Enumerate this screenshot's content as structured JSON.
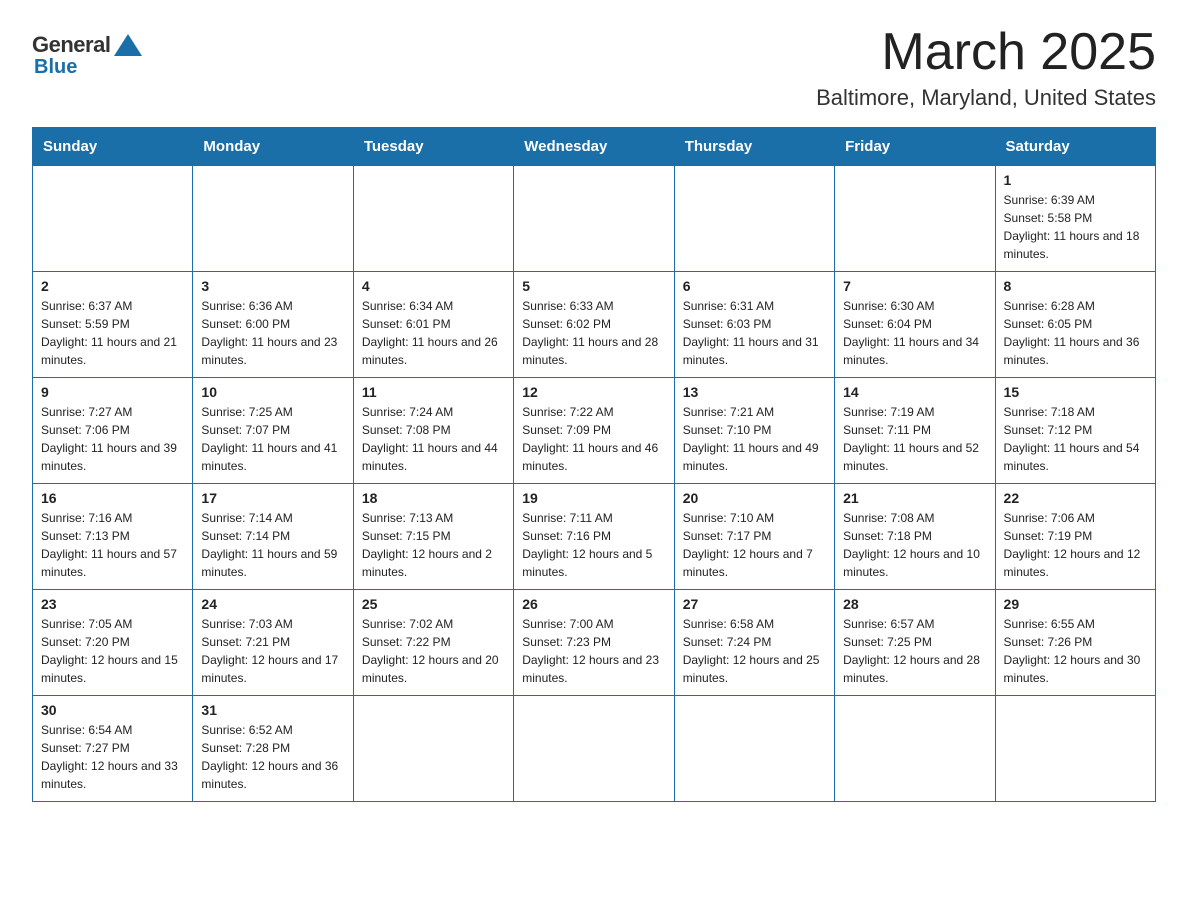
{
  "logo": {
    "general": "General",
    "blue": "Blue"
  },
  "title": "March 2025",
  "subtitle": "Baltimore, Maryland, United States",
  "days_of_week": [
    "Sunday",
    "Monday",
    "Tuesday",
    "Wednesday",
    "Thursday",
    "Friday",
    "Saturday"
  ],
  "weeks": [
    [
      {
        "day": "",
        "info": ""
      },
      {
        "day": "",
        "info": ""
      },
      {
        "day": "",
        "info": ""
      },
      {
        "day": "",
        "info": ""
      },
      {
        "day": "",
        "info": ""
      },
      {
        "day": "",
        "info": ""
      },
      {
        "day": "1",
        "info": "Sunrise: 6:39 AM\nSunset: 5:58 PM\nDaylight: 11 hours and 18 minutes."
      }
    ],
    [
      {
        "day": "2",
        "info": "Sunrise: 6:37 AM\nSunset: 5:59 PM\nDaylight: 11 hours and 21 minutes."
      },
      {
        "day": "3",
        "info": "Sunrise: 6:36 AM\nSunset: 6:00 PM\nDaylight: 11 hours and 23 minutes."
      },
      {
        "day": "4",
        "info": "Sunrise: 6:34 AM\nSunset: 6:01 PM\nDaylight: 11 hours and 26 minutes."
      },
      {
        "day": "5",
        "info": "Sunrise: 6:33 AM\nSunset: 6:02 PM\nDaylight: 11 hours and 28 minutes."
      },
      {
        "day": "6",
        "info": "Sunrise: 6:31 AM\nSunset: 6:03 PM\nDaylight: 11 hours and 31 minutes."
      },
      {
        "day": "7",
        "info": "Sunrise: 6:30 AM\nSunset: 6:04 PM\nDaylight: 11 hours and 34 minutes."
      },
      {
        "day": "8",
        "info": "Sunrise: 6:28 AM\nSunset: 6:05 PM\nDaylight: 11 hours and 36 minutes."
      }
    ],
    [
      {
        "day": "9",
        "info": "Sunrise: 7:27 AM\nSunset: 7:06 PM\nDaylight: 11 hours and 39 minutes."
      },
      {
        "day": "10",
        "info": "Sunrise: 7:25 AM\nSunset: 7:07 PM\nDaylight: 11 hours and 41 minutes."
      },
      {
        "day": "11",
        "info": "Sunrise: 7:24 AM\nSunset: 7:08 PM\nDaylight: 11 hours and 44 minutes."
      },
      {
        "day": "12",
        "info": "Sunrise: 7:22 AM\nSunset: 7:09 PM\nDaylight: 11 hours and 46 minutes."
      },
      {
        "day": "13",
        "info": "Sunrise: 7:21 AM\nSunset: 7:10 PM\nDaylight: 11 hours and 49 minutes."
      },
      {
        "day": "14",
        "info": "Sunrise: 7:19 AM\nSunset: 7:11 PM\nDaylight: 11 hours and 52 minutes."
      },
      {
        "day": "15",
        "info": "Sunrise: 7:18 AM\nSunset: 7:12 PM\nDaylight: 11 hours and 54 minutes."
      }
    ],
    [
      {
        "day": "16",
        "info": "Sunrise: 7:16 AM\nSunset: 7:13 PM\nDaylight: 11 hours and 57 minutes."
      },
      {
        "day": "17",
        "info": "Sunrise: 7:14 AM\nSunset: 7:14 PM\nDaylight: 11 hours and 59 minutes."
      },
      {
        "day": "18",
        "info": "Sunrise: 7:13 AM\nSunset: 7:15 PM\nDaylight: 12 hours and 2 minutes."
      },
      {
        "day": "19",
        "info": "Sunrise: 7:11 AM\nSunset: 7:16 PM\nDaylight: 12 hours and 5 minutes."
      },
      {
        "day": "20",
        "info": "Sunrise: 7:10 AM\nSunset: 7:17 PM\nDaylight: 12 hours and 7 minutes."
      },
      {
        "day": "21",
        "info": "Sunrise: 7:08 AM\nSunset: 7:18 PM\nDaylight: 12 hours and 10 minutes."
      },
      {
        "day": "22",
        "info": "Sunrise: 7:06 AM\nSunset: 7:19 PM\nDaylight: 12 hours and 12 minutes."
      }
    ],
    [
      {
        "day": "23",
        "info": "Sunrise: 7:05 AM\nSunset: 7:20 PM\nDaylight: 12 hours and 15 minutes."
      },
      {
        "day": "24",
        "info": "Sunrise: 7:03 AM\nSunset: 7:21 PM\nDaylight: 12 hours and 17 minutes."
      },
      {
        "day": "25",
        "info": "Sunrise: 7:02 AM\nSunset: 7:22 PM\nDaylight: 12 hours and 20 minutes."
      },
      {
        "day": "26",
        "info": "Sunrise: 7:00 AM\nSunset: 7:23 PM\nDaylight: 12 hours and 23 minutes."
      },
      {
        "day": "27",
        "info": "Sunrise: 6:58 AM\nSunset: 7:24 PM\nDaylight: 12 hours and 25 minutes."
      },
      {
        "day": "28",
        "info": "Sunrise: 6:57 AM\nSunset: 7:25 PM\nDaylight: 12 hours and 28 minutes."
      },
      {
        "day": "29",
        "info": "Sunrise: 6:55 AM\nSunset: 7:26 PM\nDaylight: 12 hours and 30 minutes."
      }
    ],
    [
      {
        "day": "30",
        "info": "Sunrise: 6:54 AM\nSunset: 7:27 PM\nDaylight: 12 hours and 33 minutes."
      },
      {
        "day": "31",
        "info": "Sunrise: 6:52 AM\nSunset: 7:28 PM\nDaylight: 12 hours and 36 minutes."
      },
      {
        "day": "",
        "info": ""
      },
      {
        "day": "",
        "info": ""
      },
      {
        "day": "",
        "info": ""
      },
      {
        "day": "",
        "info": ""
      },
      {
        "day": "",
        "info": ""
      }
    ]
  ]
}
